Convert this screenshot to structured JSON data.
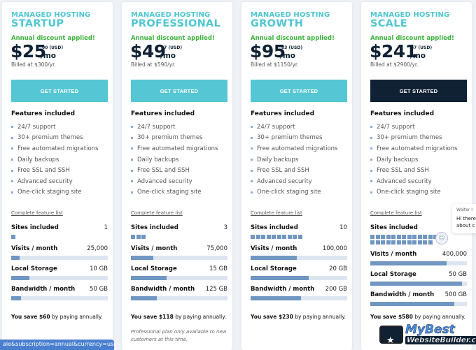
{
  "plans": [
    {
      "eyebrow": "MANAGED HOSTING",
      "name": "STARTUP",
      "discount": "Annual discount applied!",
      "price": "$25",
      "cents": "00 (USD)",
      "per": "/mo",
      "billed": "Billed at $300/yr.",
      "cta": "GET STARTED",
      "cta_style": "teal",
      "features_title": "Features included",
      "features": [
        "24/7 support",
        "30+ premium themes",
        "Free automated migrations",
        "Daily backups",
        "Free SSL and SSH",
        "Advanced security",
        "One-click staging site"
      ],
      "feature_link": "Complete feature list",
      "sites_label": "Sites included",
      "sites_value": "1",
      "sites_count": 1,
      "visits_label": "Visits / month",
      "visits_value": "25,000",
      "visits_fill": 0.09,
      "storage_label": "Local Storage",
      "storage_value": "10 GB",
      "storage_fill": 0.19,
      "bandwidth_label": "Bandwidth / month",
      "bandwidth_value": "50 GB",
      "bandwidth_fill": 0.1,
      "save_bold": "You save $60",
      "save_rest": " by paying annually.",
      "note": ""
    },
    {
      "eyebrow": "MANAGED HOSTING",
      "name": "PROFESSIONAL",
      "discount": "Annual discount applied!",
      "price": "$49",
      "cents": "17 (USD)",
      "per": "/mo",
      "billed": "Billed at $590/yr.",
      "cta": "GET STARTED",
      "cta_style": "teal",
      "features_title": "Features included",
      "features": [
        "24/7 support",
        "30+ premium themes",
        "Free automated migrations",
        "Daily backups",
        "Free SSL and SSH",
        "Advanced security",
        "One-click staging site"
      ],
      "feature_link": "Complete feature list",
      "sites_label": "Sites included",
      "sites_value": "3",
      "sites_count": 3,
      "visits_label": "Visits / month",
      "visits_value": "75,000",
      "visits_fill": 0.23,
      "storage_label": "Local Storage",
      "storage_value": "15 GB",
      "storage_fill": 0.37,
      "bandwidth_label": "Bandwidth / month",
      "bandwidth_value": "125 GB",
      "bandwidth_fill": 0.27,
      "save_bold": "You save $118",
      "save_rest": " by paying annually.",
      "note": "Professional plan only available to new customers at this time."
    },
    {
      "eyebrow": "MANAGED HOSTING",
      "name": "GROWTH",
      "discount": "Annual discount applied!",
      "price": "$95",
      "cents": "83 (USD)",
      "per": "/mo",
      "billed": "Billed at $1150/yr.",
      "cta": "GET STARTED",
      "cta_style": "teal",
      "features_title": "Features included",
      "features": [
        "24/7 support",
        "30+ premium themes",
        "Free automated migrations",
        "Daily backups",
        "Free SSL and SSH",
        "Advanced security",
        "One-click staging site"
      ],
      "feature_link": "Complete feature list",
      "sites_label": "Sites included",
      "sites_value": "10",
      "sites_count": 10,
      "visits_label": "Visits / month",
      "visits_value": "100,000",
      "visits_fill": 0.48,
      "storage_label": "Local Storage",
      "storage_value": "20 GB",
      "storage_fill": 0.6,
      "bandwidth_label": "Bandwidth / month",
      "bandwidth_value": "200 GB",
      "bandwidth_fill": 0.52,
      "save_bold": "You save $230",
      "save_rest": " by paying annually.",
      "note": ""
    },
    {
      "eyebrow": "MANAGED HOSTING",
      "name": "SCALE",
      "discount": "Annual discount applied!",
      "price": "$241",
      "cents": "67 (USD)",
      "per": "/mo",
      "billed": "Billed at $2900/yr.",
      "cta": "GET STARTED",
      "cta_style": "dark",
      "features_title": "Features included",
      "features": [
        "24/7 support",
        "30+ premium themes",
        "Free automated migrations",
        "Daily backups",
        "Free SSL and SSH",
        "Advanced security",
        "One-click staging site"
      ],
      "feature_link": "Complete feature list",
      "sites_label": "Sites included",
      "sites_value": "",
      "sites_count": 26,
      "visits_label": "Visits / month",
      "visits_value": "400,000",
      "visits_fill": 0.79,
      "storage_label": "Local Storage",
      "storage_value": "50 GB",
      "storage_fill": 0.95,
      "bandwidth_label": "Bandwidth / month",
      "bandwidth_value": "500 GB",
      "bandwidth_fill": 0.87,
      "save_bold": "You save $580",
      "save_rest": " by paying annually.",
      "note": ""
    }
  ],
  "status_url": "ale&subscription=annual&currency=usd",
  "chat": {
    "agent": "Walter I",
    "message_line1": "Hi there",
    "message_line2": "about c"
  },
  "watermark": {
    "line1": "MyBest",
    "line2": "WebsiteBuilder.com"
  },
  "colors": {
    "accent": "#4fc6d3",
    "discount": "#3db13d",
    "dark": "#0f2133",
    "bar": "#7096c2",
    "bar_bg": "#dde6f0"
  }
}
